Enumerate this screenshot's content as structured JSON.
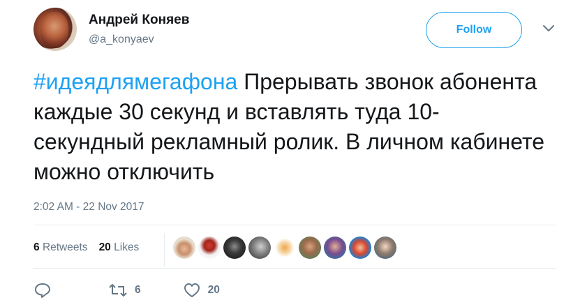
{
  "user": {
    "name": "Андрей Коняев",
    "handle": "@a_konyaev"
  },
  "follow_label": "Follow",
  "tweet": {
    "hashtag": "#идеядлямегафона",
    "text": " Прерывать звонок абонента каждые 30 секунд и вставлять туда 10-секундный рекламный ролик. В личном кабинете можно отключить"
  },
  "timestamp": "2:02 AM - 22 Nov 2017",
  "stats": {
    "retweets_count": "6",
    "retweets_label": "Retweets",
    "likes_count": "20",
    "likes_label": "Likes"
  },
  "actions": {
    "reply_icon": "reply-icon",
    "retweet_icon": "retweet-icon",
    "retweet_count": "6",
    "like_icon": "heart-icon",
    "like_count": "20"
  },
  "colors": {
    "accent": "#1da1f2",
    "muted": "#657786",
    "text": "#14171a",
    "divider": "#e6ecf0"
  }
}
